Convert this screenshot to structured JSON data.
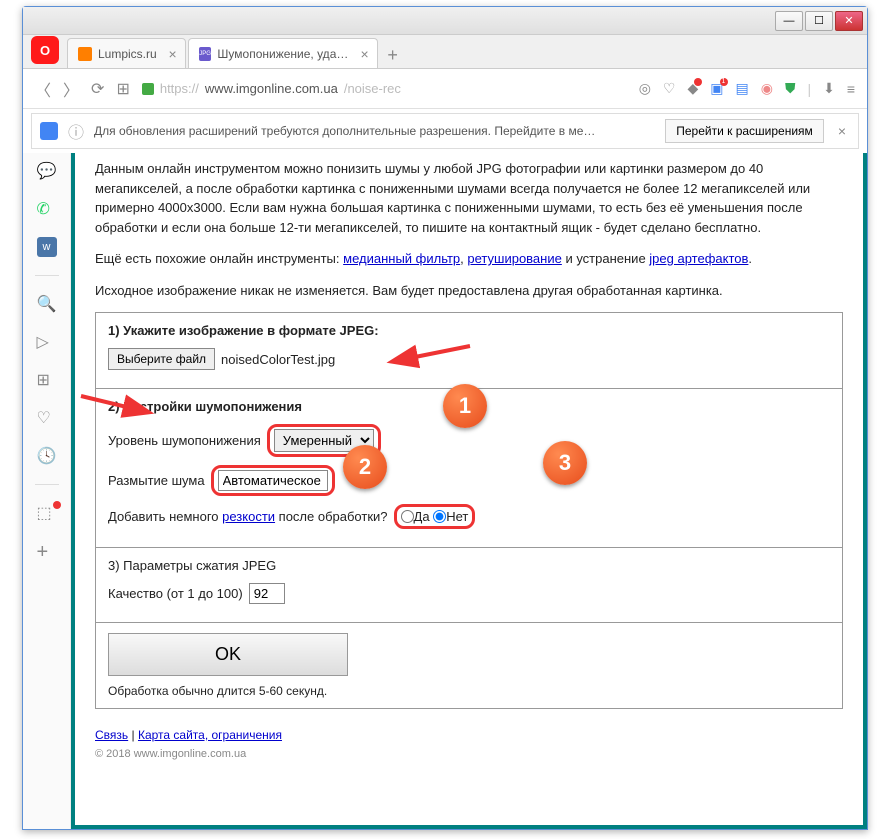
{
  "window": {
    "min": "—",
    "max": "☐",
    "close": "✕"
  },
  "tabs": [
    {
      "label": "Lumpics.ru",
      "favcolor": "#ff7f00",
      "active": false
    },
    {
      "label": "Шумопонижение, удалить",
      "favcolor": "#6a5acd",
      "favtext": "JPG",
      "active": true
    }
  ],
  "addressbar": {
    "url_prefix": "https://",
    "url_host": "www.imgonline.com.ua",
    "url_path": "/noise-rec"
  },
  "notif": {
    "text": "Для обновления расширений требуются дополнительные разрешения. Перейдите в ме…",
    "button": "Перейти к расширениям"
  },
  "intro": {
    "p1": "Данным онлайн инструментом можно понизить шумы у любой JPG фотографии или картинки размером до 40 мегапикселей, а после обработки картинка с пониженными шумами всегда получается не более 12 мегапикселей или примерно 4000x3000. Если вам нужна большая картинка с пониженными шумами, то есть без её уменьшения после обработки и если она больше 12-ти мегапикселей, то пишите на контактный ящик - будет сделано бесплатно.",
    "p2a": "Ещё есть похожие онлайн инструменты: ",
    "link1": "медианный фильтр",
    "sep1": ", ",
    "link2": "ретуширование",
    "sep2": " и устранение ",
    "link3": "jpeg артефактов",
    "period": ".",
    "p3": "Исходное изображение никак не изменяется. Вам будет предоставлена другая обработанная картинка."
  },
  "step1": {
    "title": "1) Укажите изображение в формате JPEG:",
    "choose": "Выберите файл",
    "filename": "noisedColorTest.jpg"
  },
  "step2": {
    "title": "2) Настройки шумопонижения",
    "level_label": "Уровень шумопонижения",
    "level_value": "Умеренный",
    "blur_label": "Размытие шума",
    "blur_value": "Автоматическое",
    "sharp_label_a": "Добавить немного ",
    "sharp_link": "резкости",
    "sharp_label_b": " после обработки?",
    "yes": "Да",
    "no": "Нет"
  },
  "step3": {
    "title": "3) Параметры сжатия JPEG",
    "quality_label": "Качество (от 1 до 100)",
    "quality_value": "92"
  },
  "submit": {
    "ok": "OK",
    "hint": "Обработка обычно длится 5-60 секунд."
  },
  "footer": {
    "link1": "Связь",
    "sep": " | ",
    "link2": "Карта сайта, ограничения",
    "copy": "© 2018 www.imgonline.com.ua"
  },
  "badges": {
    "b1": "1",
    "b2": "2",
    "b3": "3"
  }
}
